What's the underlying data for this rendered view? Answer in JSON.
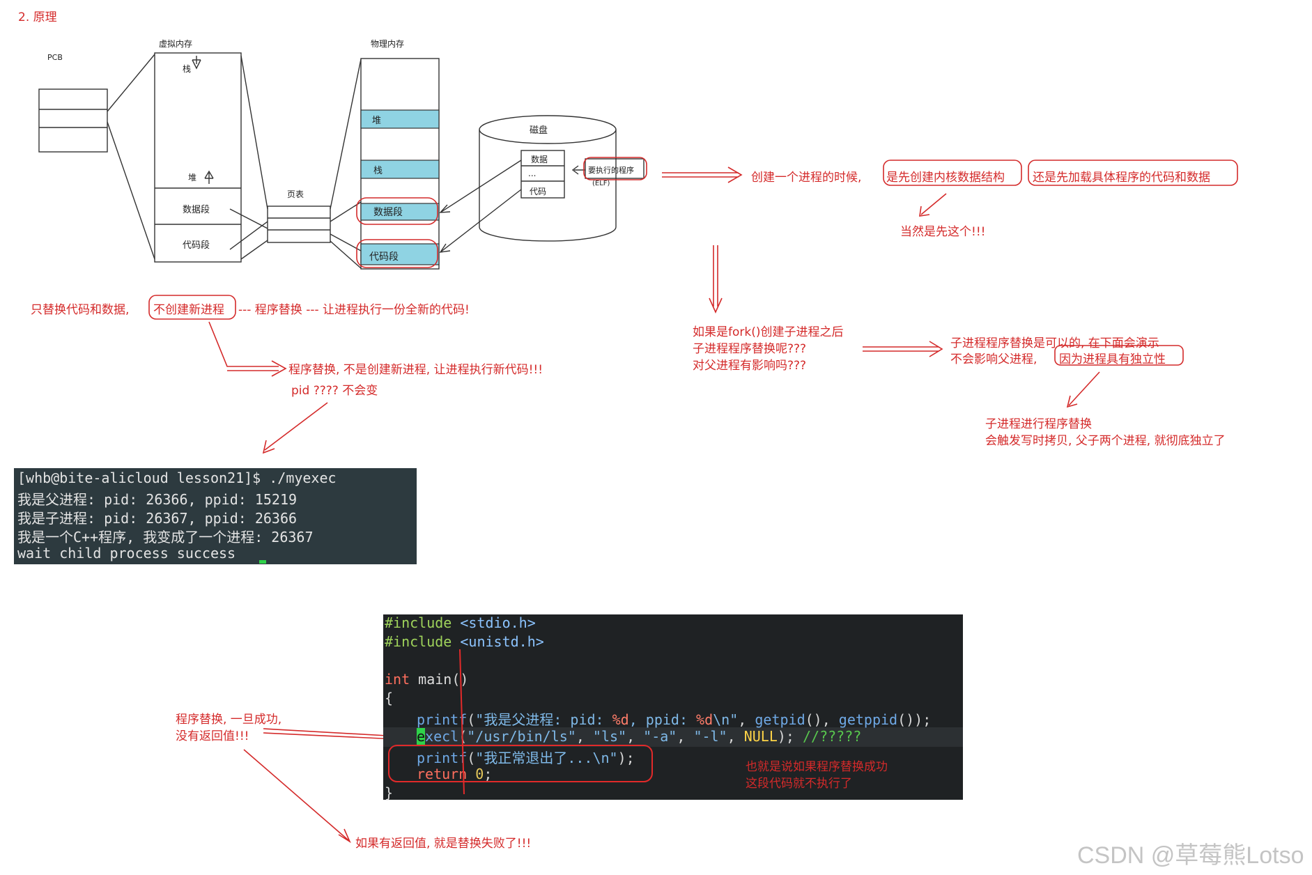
{
  "section_title": "2. 原理",
  "diagram": {
    "pcb_label": "PCB",
    "virtual_mem_label": "虚拟内存",
    "stack_label": "栈",
    "heap_label": "堆",
    "data_seg_label": "数据段",
    "code_seg_label": "代码段",
    "page_table_label": "页表",
    "physical_mem_label": "物理内存",
    "phys_heap": "堆",
    "phys_stack": "栈",
    "phys_data": "数据段",
    "phys_code": "代码段",
    "disk_label": "磁盘",
    "disk_data": "数据",
    "disk_dots": "...",
    "disk_code": "代码",
    "program_label": "要执行的程序",
    "elf_label": "(ELF)"
  },
  "notes": {
    "only_replace": "只替换代码和数据,",
    "no_new_process": "不创建新进程",
    "replace_tail": "--- 程序替换 --- 让进程执行一份全新的代码!",
    "replace_desc": "程序替换, 不是创建新进程, 让进程执行新代码!!!",
    "pid_note": "pid ???? 不会变",
    "create_q_part1": "创建一个进程的时候,",
    "create_q_part2": "是先创建内核数据结构",
    "create_q_part3": "还是先加载具体程序的代码和数据",
    "of_course": "当然是先这个!!!",
    "fork_q1": "如果是fork()创建子进程之后",
    "fork_q2": "子进程程序替换呢???",
    "fork_q3": "对父进程有影响吗???",
    "child_a1": "子进程程序替换是可以的, 在下面会演示",
    "child_a2_part1": "不会影响父进程,",
    "child_a2_part2": "因为进程具有独立性",
    "cow1": "子进程进行程序替换",
    "cow2": "会触发写时拷贝, 父子两个进程, 就彻底独立了",
    "success_note1": "程序替换, 一旦成功,",
    "success_note2": "没有返回值!!!",
    "fail_note": "如果有返回值, 就是替换失败了!!!",
    "not_exec1": "也就是说如果程序替换成功",
    "not_exec2": "这段代码就不执行了"
  },
  "terminal": {
    "lines": [
      "[whb@bite-alicloud lesson21]$ ./myexec",
      "我是父进程: pid: 26366, ppid: 15219",
      "我是子进程: pid: 26367, ppid: 26366",
      "我是一个C++程序, 我变成了一个进程: 26367",
      "wait child process success"
    ]
  },
  "code": {
    "inc1_kw": "#include",
    "inc1_file": "<stdio.h>",
    "inc2_kw": "#include",
    "inc2_file": "<unistd.h>",
    "main_type": "int",
    "main_name": "main",
    "main_paren": "()",
    "open_brace": "{",
    "p1_fn": "printf",
    "p1_open": "(",
    "p1_str_a": "\"我是父进程: pid: ",
    "p1_fmt_a": "%d",
    "p1_str_b": ", ppid: ",
    "p1_fmt_b": "%d",
    "p1_str_c": "\\n\"",
    "p1_sep1": ", ",
    "p1_call1": "getpid",
    "p1_sep2": "(), ",
    "p1_call2": "getppid",
    "p1_close": "());",
    "ex_cursor": "e",
    "ex_fn": "xecl",
    "ex_open": "(",
    "ex_a1": "\"/usr/bin/ls\"",
    "ex_c1": ", ",
    "ex_a2": "\"ls\"",
    "ex_c2": ", ",
    "ex_a3": "\"-a\"",
    "ex_c3": ", ",
    "ex_a4": "\"-l\"",
    "ex_c4": ", ",
    "ex_null": "NULL",
    "ex_close": "); ",
    "ex_comment": "//?????",
    "p2_fn": "printf",
    "p2_open": "(",
    "p2_str": "\"我正常退出了...\\n\"",
    "p2_close": ");",
    "ret_kw": "return",
    "ret_val": "0",
    "ret_semi": ";",
    "close_brace": "}"
  },
  "watermark": "CSDN @草莓熊Lotso",
  "colors": {
    "annotation": "#d42a2a",
    "phys_block": "#8fd3e3",
    "terminal_bg": "#2d3a3f",
    "code_bg": "#1f2224"
  }
}
